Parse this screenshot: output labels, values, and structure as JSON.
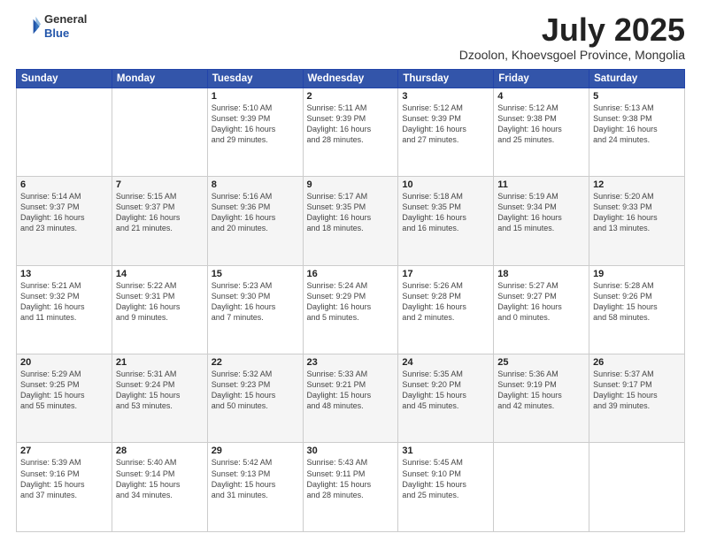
{
  "header": {
    "logo": {
      "general": "General",
      "blue": "Blue"
    },
    "title": "July 2025",
    "subtitle": "Dzoolon, Khoevsgoel Province, Mongolia"
  },
  "calendar": {
    "days": [
      "Sunday",
      "Monday",
      "Tuesday",
      "Wednesday",
      "Thursday",
      "Friday",
      "Saturday"
    ],
    "weeks": [
      [
        {
          "day": "",
          "info": ""
        },
        {
          "day": "",
          "info": ""
        },
        {
          "day": "1",
          "info": "Sunrise: 5:10 AM\nSunset: 9:39 PM\nDaylight: 16 hours\nand 29 minutes."
        },
        {
          "day": "2",
          "info": "Sunrise: 5:11 AM\nSunset: 9:39 PM\nDaylight: 16 hours\nand 28 minutes."
        },
        {
          "day": "3",
          "info": "Sunrise: 5:12 AM\nSunset: 9:39 PM\nDaylight: 16 hours\nand 27 minutes."
        },
        {
          "day": "4",
          "info": "Sunrise: 5:12 AM\nSunset: 9:38 PM\nDaylight: 16 hours\nand 25 minutes."
        },
        {
          "day": "5",
          "info": "Sunrise: 5:13 AM\nSunset: 9:38 PM\nDaylight: 16 hours\nand 24 minutes."
        }
      ],
      [
        {
          "day": "6",
          "info": "Sunrise: 5:14 AM\nSunset: 9:37 PM\nDaylight: 16 hours\nand 23 minutes."
        },
        {
          "day": "7",
          "info": "Sunrise: 5:15 AM\nSunset: 9:37 PM\nDaylight: 16 hours\nand 21 minutes."
        },
        {
          "day": "8",
          "info": "Sunrise: 5:16 AM\nSunset: 9:36 PM\nDaylight: 16 hours\nand 20 minutes."
        },
        {
          "day": "9",
          "info": "Sunrise: 5:17 AM\nSunset: 9:35 PM\nDaylight: 16 hours\nand 18 minutes."
        },
        {
          "day": "10",
          "info": "Sunrise: 5:18 AM\nSunset: 9:35 PM\nDaylight: 16 hours\nand 16 minutes."
        },
        {
          "day": "11",
          "info": "Sunrise: 5:19 AM\nSunset: 9:34 PM\nDaylight: 16 hours\nand 15 minutes."
        },
        {
          "day": "12",
          "info": "Sunrise: 5:20 AM\nSunset: 9:33 PM\nDaylight: 16 hours\nand 13 minutes."
        }
      ],
      [
        {
          "day": "13",
          "info": "Sunrise: 5:21 AM\nSunset: 9:32 PM\nDaylight: 16 hours\nand 11 minutes."
        },
        {
          "day": "14",
          "info": "Sunrise: 5:22 AM\nSunset: 9:31 PM\nDaylight: 16 hours\nand 9 minutes."
        },
        {
          "day": "15",
          "info": "Sunrise: 5:23 AM\nSunset: 9:30 PM\nDaylight: 16 hours\nand 7 minutes."
        },
        {
          "day": "16",
          "info": "Sunrise: 5:24 AM\nSunset: 9:29 PM\nDaylight: 16 hours\nand 5 minutes."
        },
        {
          "day": "17",
          "info": "Sunrise: 5:26 AM\nSunset: 9:28 PM\nDaylight: 16 hours\nand 2 minutes."
        },
        {
          "day": "18",
          "info": "Sunrise: 5:27 AM\nSunset: 9:27 PM\nDaylight: 16 hours\nand 0 minutes."
        },
        {
          "day": "19",
          "info": "Sunrise: 5:28 AM\nSunset: 9:26 PM\nDaylight: 15 hours\nand 58 minutes."
        }
      ],
      [
        {
          "day": "20",
          "info": "Sunrise: 5:29 AM\nSunset: 9:25 PM\nDaylight: 15 hours\nand 55 minutes."
        },
        {
          "day": "21",
          "info": "Sunrise: 5:31 AM\nSunset: 9:24 PM\nDaylight: 15 hours\nand 53 minutes."
        },
        {
          "day": "22",
          "info": "Sunrise: 5:32 AM\nSunset: 9:23 PM\nDaylight: 15 hours\nand 50 minutes."
        },
        {
          "day": "23",
          "info": "Sunrise: 5:33 AM\nSunset: 9:21 PM\nDaylight: 15 hours\nand 48 minutes."
        },
        {
          "day": "24",
          "info": "Sunrise: 5:35 AM\nSunset: 9:20 PM\nDaylight: 15 hours\nand 45 minutes."
        },
        {
          "day": "25",
          "info": "Sunrise: 5:36 AM\nSunset: 9:19 PM\nDaylight: 15 hours\nand 42 minutes."
        },
        {
          "day": "26",
          "info": "Sunrise: 5:37 AM\nSunset: 9:17 PM\nDaylight: 15 hours\nand 39 minutes."
        }
      ],
      [
        {
          "day": "27",
          "info": "Sunrise: 5:39 AM\nSunset: 9:16 PM\nDaylight: 15 hours\nand 37 minutes."
        },
        {
          "day": "28",
          "info": "Sunrise: 5:40 AM\nSunset: 9:14 PM\nDaylight: 15 hours\nand 34 minutes."
        },
        {
          "day": "29",
          "info": "Sunrise: 5:42 AM\nSunset: 9:13 PM\nDaylight: 15 hours\nand 31 minutes."
        },
        {
          "day": "30",
          "info": "Sunrise: 5:43 AM\nSunset: 9:11 PM\nDaylight: 15 hours\nand 28 minutes."
        },
        {
          "day": "31",
          "info": "Sunrise: 5:45 AM\nSunset: 9:10 PM\nDaylight: 15 hours\nand 25 minutes."
        },
        {
          "day": "",
          "info": ""
        },
        {
          "day": "",
          "info": ""
        }
      ]
    ]
  }
}
